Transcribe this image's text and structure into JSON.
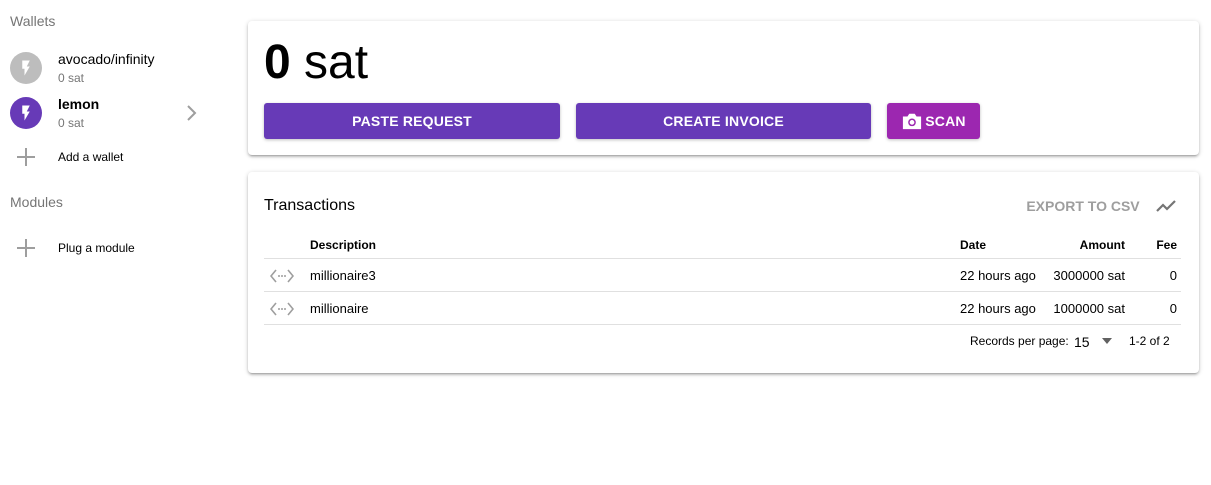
{
  "sidebar": {
    "wallets_header": "Wallets",
    "wallets": [
      {
        "name": "avocado/infinity",
        "balance": "0 sat",
        "active": false,
        "icon": "lightning-bolt-icon",
        "avatar_color": "#bdbdbd"
      },
      {
        "name": "lemon",
        "balance": "0 sat",
        "active": true,
        "icon": "lightning-bolt-icon",
        "avatar_color": "#673ab7"
      }
    ],
    "add_wallet_label": "Add a wallet",
    "modules_header": "Modules",
    "plug_module_label": "Plug a module"
  },
  "balance": {
    "amount": "0",
    "unit": "sat"
  },
  "actions": {
    "paste_request": "PASTE REQUEST",
    "create_invoice": "CREATE INVOICE",
    "scan": "SCAN",
    "primary_color": "#673ab7",
    "scan_color": "#9c27b0"
  },
  "transactions": {
    "title": "Transactions",
    "export_label": "EXPORT TO CSV",
    "columns": {
      "description": "Description",
      "date": "Date",
      "amount": "Amount",
      "fee": "Fee"
    },
    "rows": [
      {
        "description": "millionaire3",
        "date": "22 hours ago",
        "amount": "3000000 sat",
        "fee": "0"
      },
      {
        "description": "millionaire",
        "date": "22 hours ago",
        "amount": "1000000 sat",
        "fee": "0"
      }
    ],
    "footer": {
      "records_per_page_label": "Records per page:",
      "records_per_page_value": "15",
      "range": "1-2 of 2"
    }
  }
}
